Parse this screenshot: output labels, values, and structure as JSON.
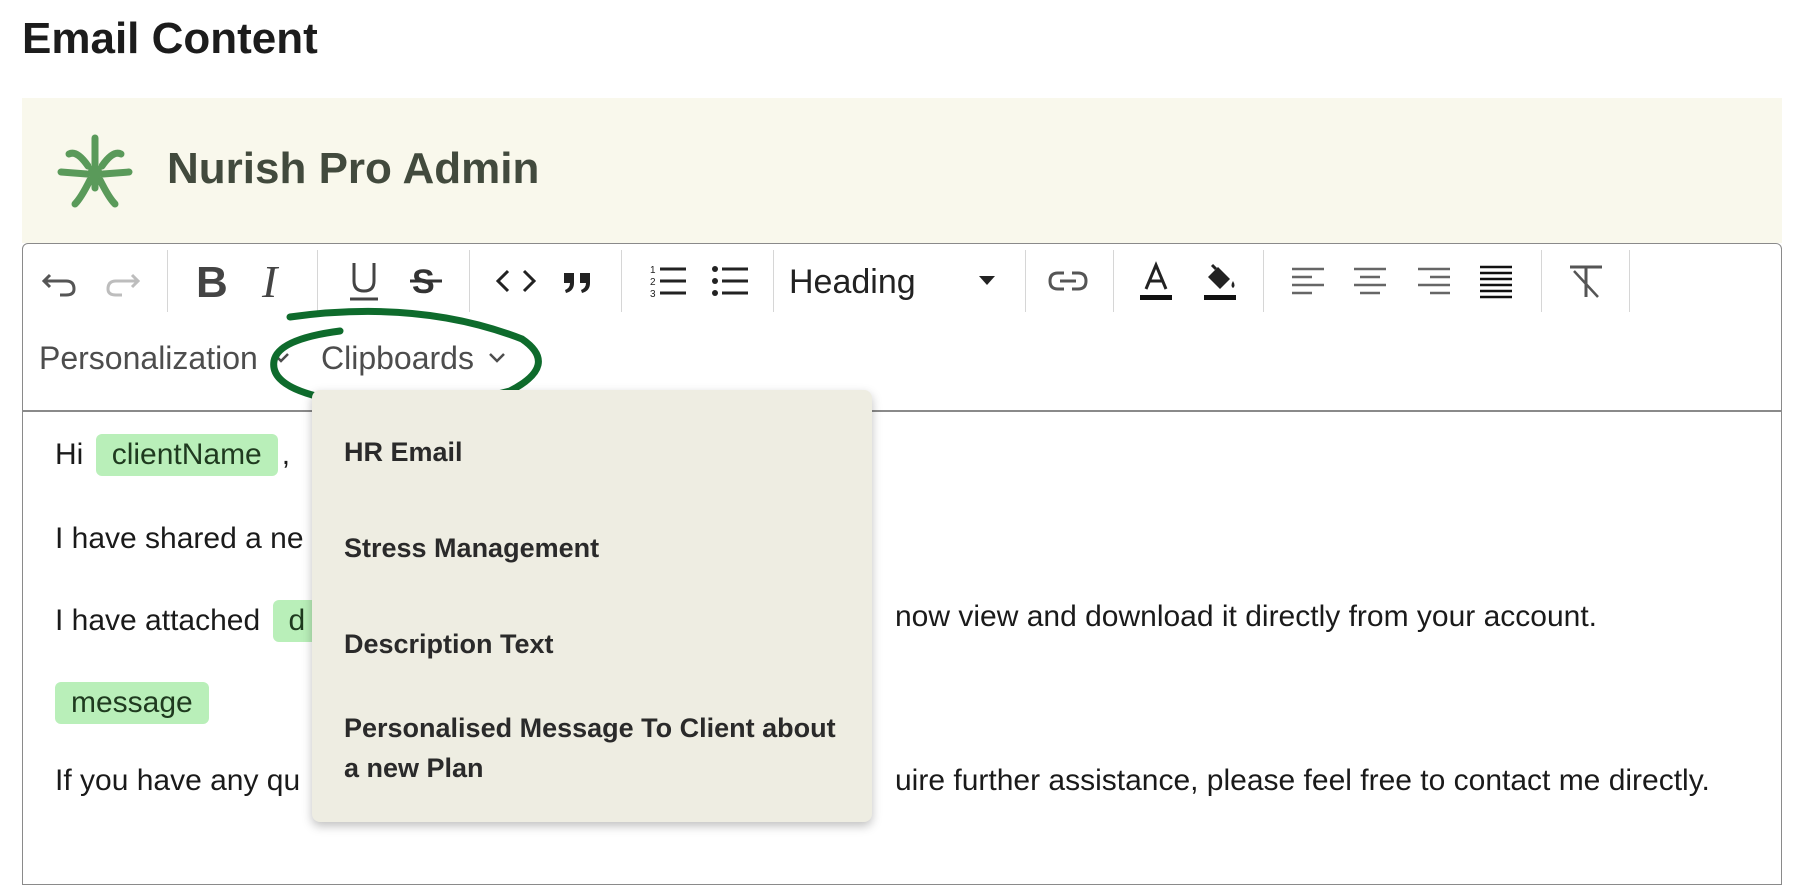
{
  "page": {
    "title": "Email Content"
  },
  "brand": {
    "name": "Nurish Pro Admin"
  },
  "toolbar": {
    "heading_select": "Heading",
    "personalization_menu": "Personalization",
    "clipboards_menu": "Clipboards"
  },
  "icons": {
    "undo": "undo-icon",
    "redo": "redo-icon",
    "bold": "bold-icon",
    "italic": "italic-icon",
    "underline": "underline-icon",
    "strikethrough": "strikethrough-icon",
    "code": "code-icon",
    "quote": "quote-icon",
    "ordered_list": "ordered-list-icon",
    "bullet_list": "bullet-list-icon",
    "link": "link-icon",
    "text_color": "text-color-icon",
    "highlight": "highlight-icon",
    "align_left": "align-left-icon",
    "align_center": "align-center-icon",
    "align_right": "align-right-icon",
    "align_justify": "align-justify-icon",
    "clear_format": "clear-format-icon"
  },
  "content": {
    "greeting_prefix": "Hi",
    "client_chip": "clientName",
    "greeting_suffix": ",",
    "line2_visible": "I have shared a ne",
    "line3_prefix": "I have attached",
    "line3_chip_visible": "d",
    "line3_suffix": "now view and download it directly from your account.",
    "message_chip": "message",
    "line5_prefix": "If you have any qu",
    "line5_suffix": "uire further assistance, please feel free to contact me directly."
  },
  "clipboards_dropdown": {
    "items": [
      "HR Email",
      "Stress Management",
      "Description Text",
      "Personalised Message To Client about a new Plan"
    ]
  },
  "colors": {
    "brand_bar": "#f9f8ec",
    "logo_green": "#5a9a5a",
    "chip_green": "#b9efb9",
    "annotation_green": "#0e6b2c",
    "dropdown_bg": "#eeede2"
  }
}
